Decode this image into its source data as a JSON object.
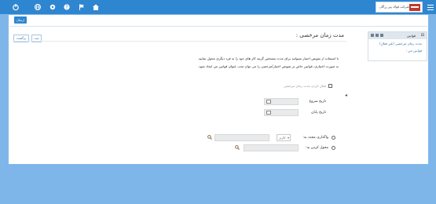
{
  "topbar": {
    "company_name": "شرکت فولاد پیر زرگان",
    "icons": [
      "home-icon",
      "flag-icon",
      "help-icon",
      "settings-icon",
      "globe-icon",
      "power-icon",
      "menu-icon"
    ],
    "color": "#2f86d0"
  },
  "toolbar": {
    "send_label": "ارسال"
  },
  "form": {
    "title": "مدت زمان مرخصی :",
    "save_label": "ثبت",
    "back_label": "برگشت",
    "paragraph1": "با استفاده از تفویض اختیار میتوانید برای مدت مشخص گزینه کار های خود را به فرد دیگری محول نمایید.",
    "paragraph2": "به صورت اختیاری، قوانین خاص تر تفویض اختیار/مرخصی را می توان تحت عنوان قوانین من ایجاد نمود.",
    "enable_label": "فعال کردن مدت زمان مرخصی",
    "start_date_label": "تاریخ شروع",
    "end_date_label": "تاریخ پایان",
    "reassign_label": "واگذاری مجدد به:",
    "reassign_select": "کاربر",
    "delegate_label": "محول کردن به:"
  },
  "tree": {
    "header": "قوانین",
    "items": [
      "مدت زمان مرخصی (غیر فعال)",
      "قوانین من :"
    ]
  }
}
